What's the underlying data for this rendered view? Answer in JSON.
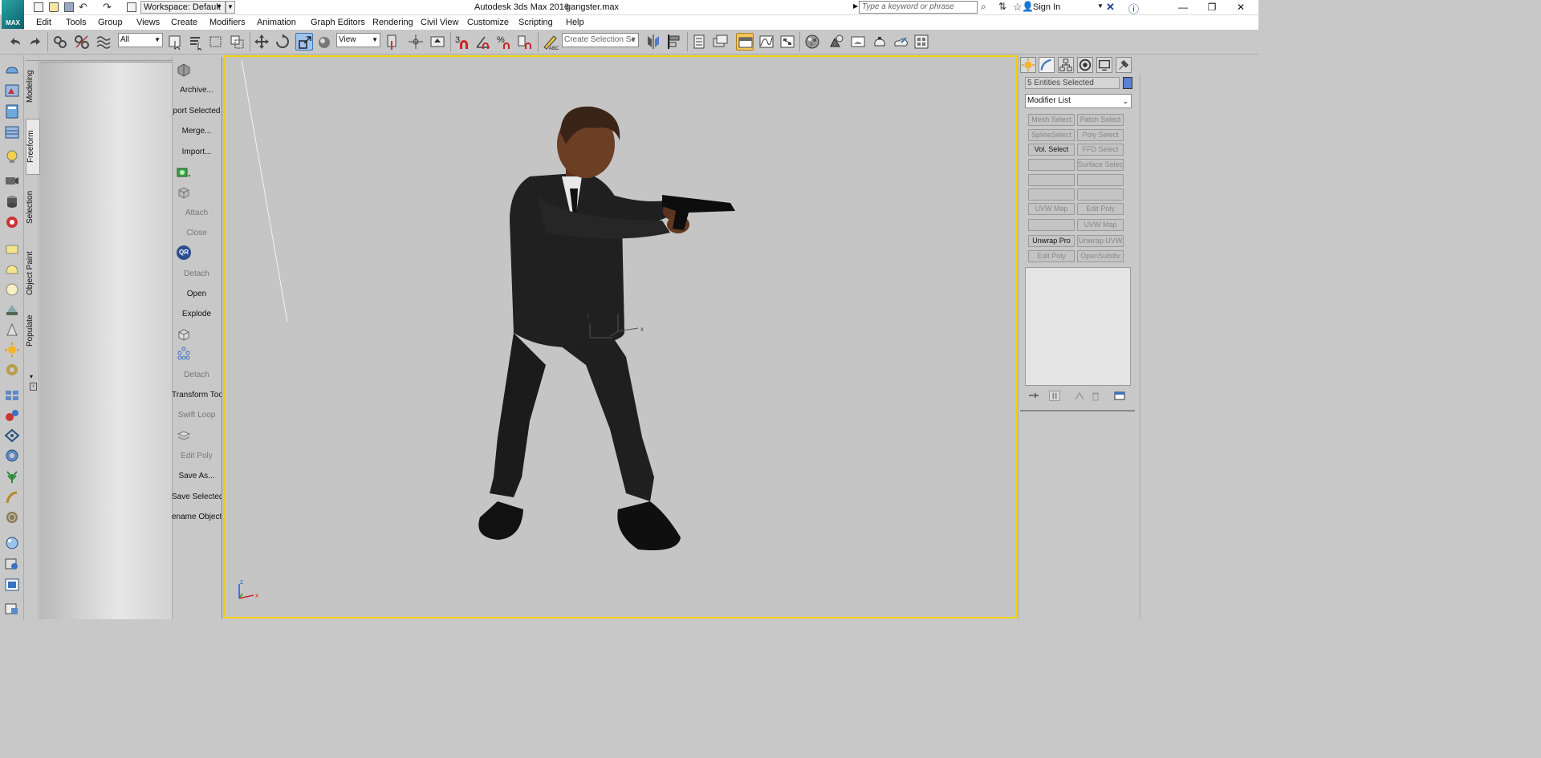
{
  "app": {
    "title": "Autodesk 3ds Max 2016",
    "file": "gangster.max",
    "logo_text": "MAX"
  },
  "workspace": {
    "label": "Workspace: Default"
  },
  "search": {
    "placeholder": "Type a keyword or phrase"
  },
  "account": {
    "signin_label": "Sign In"
  },
  "menu": [
    "Edit",
    "Tools",
    "Group",
    "Views",
    "Create",
    "Modifiers",
    "Animation",
    "Graph Editors",
    "Rendering",
    "Civil View",
    "Customize",
    "Scripting",
    "Help"
  ],
  "toolbar": {
    "filter_value": "All",
    "refcoord_value": "View",
    "selection_set_placeholder": "Create Selection Se"
  },
  "ribbon_tabs": [
    "Modeling",
    "Freeform",
    "Selection",
    "Object Paint",
    "Populate"
  ],
  "ribbon_active_tab": "Freeform",
  "ribbon_items": [
    {
      "label": "Archive...",
      "enabled": true
    },
    {
      "label": "port Selected",
      "enabled": true
    },
    {
      "label": "Merge...",
      "enabled": true
    },
    {
      "label": "Import...",
      "enabled": true
    },
    {
      "label": "Attach",
      "enabled": false
    },
    {
      "label": "Close",
      "enabled": false
    },
    {
      "label": "Detach",
      "enabled": false
    },
    {
      "label": "Open",
      "enabled": true
    },
    {
      "label": "Explode",
      "enabled": true
    },
    {
      "label": "Detach",
      "enabled": false
    },
    {
      "label": "Transform Tool",
      "enabled": true
    },
    {
      "label": "Swift Loop",
      "enabled": false
    },
    {
      "label": "Edit Poly",
      "enabled": false
    },
    {
      "label": "Save As...",
      "enabled": true
    },
    {
      "label": "Save Selected",
      "enabled": true
    },
    {
      "label": "ename Objects",
      "enabled": true
    }
  ],
  "qr_badge": "QR",
  "viewport": {
    "axis_x": "x",
    "axis_y": "y",
    "axis_z": "z",
    "gizmo_x": "x",
    "gizmo_z": "z"
  },
  "command_panel": {
    "selection_name": "5 Entities Selected",
    "selection_color": "#5b7fd4",
    "modifier_list_label": "Modifier List",
    "modifier_buttons": [
      {
        "label": "Mesh Select",
        "enabled": false
      },
      {
        "label": "Patch Select",
        "enabled": false
      },
      {
        "label": "SplineSelect",
        "enabled": false
      },
      {
        "label": "Poly Select",
        "enabled": false
      },
      {
        "label": "Vol. Select",
        "enabled": true
      },
      {
        "label": "FFD Select",
        "enabled": false
      },
      {
        "label": "",
        "enabled": false
      },
      {
        "label": "Surface Select",
        "enabled": false
      },
      {
        "label": "",
        "enabled": false
      },
      {
        "label": "",
        "enabled": false
      },
      {
        "label": "",
        "enabled": false
      },
      {
        "label": "",
        "enabled": false
      },
      {
        "label": "UVW Map",
        "enabled": false
      },
      {
        "label": "Edit Poly",
        "enabled": false
      },
      {
        "label": "",
        "enabled": false
      },
      {
        "label": "UVW Map",
        "enabled": false
      },
      {
        "label": "Unwrap Pro",
        "enabled": true
      },
      {
        "label": "Unwrap UVW",
        "enabled": false
      },
      {
        "label": "Edit Poly",
        "enabled": false
      },
      {
        "label": "OpenSubdiv",
        "enabled": false
      }
    ]
  },
  "colors": {
    "viewport_border_active": "#f0d000",
    "ui_gray": "#c8c8c8",
    "active_tool": "#f3c55a"
  }
}
